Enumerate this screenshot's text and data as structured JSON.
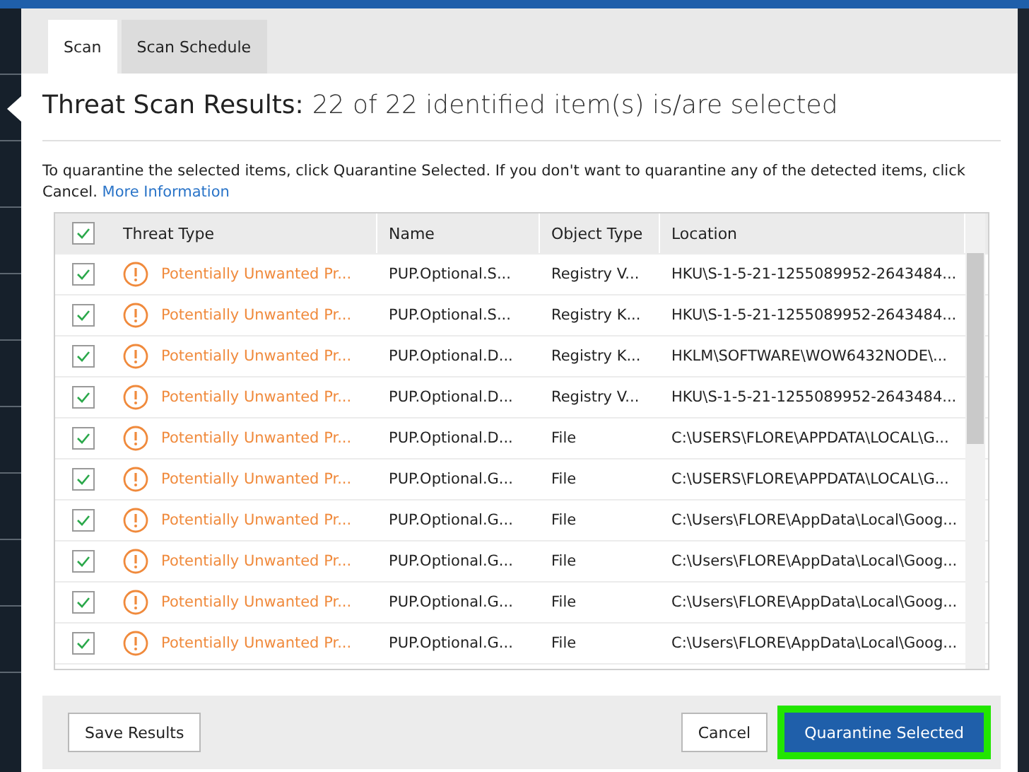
{
  "tabs": [
    {
      "label": "Scan",
      "selected": true
    },
    {
      "label": "Scan Schedule",
      "selected": false
    }
  ],
  "heading": {
    "title": "Threat Scan Results:",
    "summary": "22 of 22 identified item(s) is/are selected"
  },
  "instructions": {
    "text": "To quarantine the selected items, click Quarantine Selected. If you don't want to quarantine any of the detected items, click Cancel.",
    "link": "More Information"
  },
  "table": {
    "all_checked": true,
    "columns": [
      "Threat Type",
      "Name",
      "Object Type",
      "Location"
    ],
    "rows": [
      {
        "checked": true,
        "threat_type": "Potentially Unwanted Pr...",
        "name": "PUP.Optional.S...",
        "object_type": "Registry V...",
        "location": "HKU\\S-1-5-21-1255089952-2643484..."
      },
      {
        "checked": true,
        "threat_type": "Potentially Unwanted Pr...",
        "name": "PUP.Optional.S...",
        "object_type": "Registry K...",
        "location": "HKU\\S-1-5-21-1255089952-2643484..."
      },
      {
        "checked": true,
        "threat_type": "Potentially Unwanted Pr...",
        "name": "PUP.Optional.D...",
        "object_type": "Registry K...",
        "location": "HKLM\\SOFTWARE\\WOW6432NODE\\..."
      },
      {
        "checked": true,
        "threat_type": "Potentially Unwanted Pr...",
        "name": "PUP.Optional.D...",
        "object_type": "Registry V...",
        "location": "HKU\\S-1-5-21-1255089952-2643484..."
      },
      {
        "checked": true,
        "threat_type": "Potentially Unwanted Pr...",
        "name": "PUP.Optional.D...",
        "object_type": "File",
        "location": "C:\\USERS\\FLORE\\APPDATA\\LOCAL\\G..."
      },
      {
        "checked": true,
        "threat_type": "Potentially Unwanted Pr...",
        "name": "PUP.Optional.G...",
        "object_type": "File",
        "location": "C:\\USERS\\FLORE\\APPDATA\\LOCAL\\G..."
      },
      {
        "checked": true,
        "threat_type": "Potentially Unwanted Pr...",
        "name": "PUP.Optional.G...",
        "object_type": "File",
        "location": "C:\\Users\\FLORE\\AppData\\Local\\Goog..."
      },
      {
        "checked": true,
        "threat_type": "Potentially Unwanted Pr...",
        "name": "PUP.Optional.G...",
        "object_type": "File",
        "location": "C:\\Users\\FLORE\\AppData\\Local\\Goog..."
      },
      {
        "checked": true,
        "threat_type": "Potentially Unwanted Pr...",
        "name": "PUP.Optional.G...",
        "object_type": "File",
        "location": "C:\\Users\\FLORE\\AppData\\Local\\Goog..."
      },
      {
        "checked": true,
        "threat_type": "Potentially Unwanted Pr...",
        "name": "PUP.Optional.G...",
        "object_type": "File",
        "location": "C:\\Users\\FLORE\\AppData\\Local\\Goog..."
      }
    ]
  },
  "footer": {
    "save": "Save Results",
    "cancel": "Cancel",
    "quarantine": "Quarantine Selected",
    "quarantine_highlighted": true
  }
}
